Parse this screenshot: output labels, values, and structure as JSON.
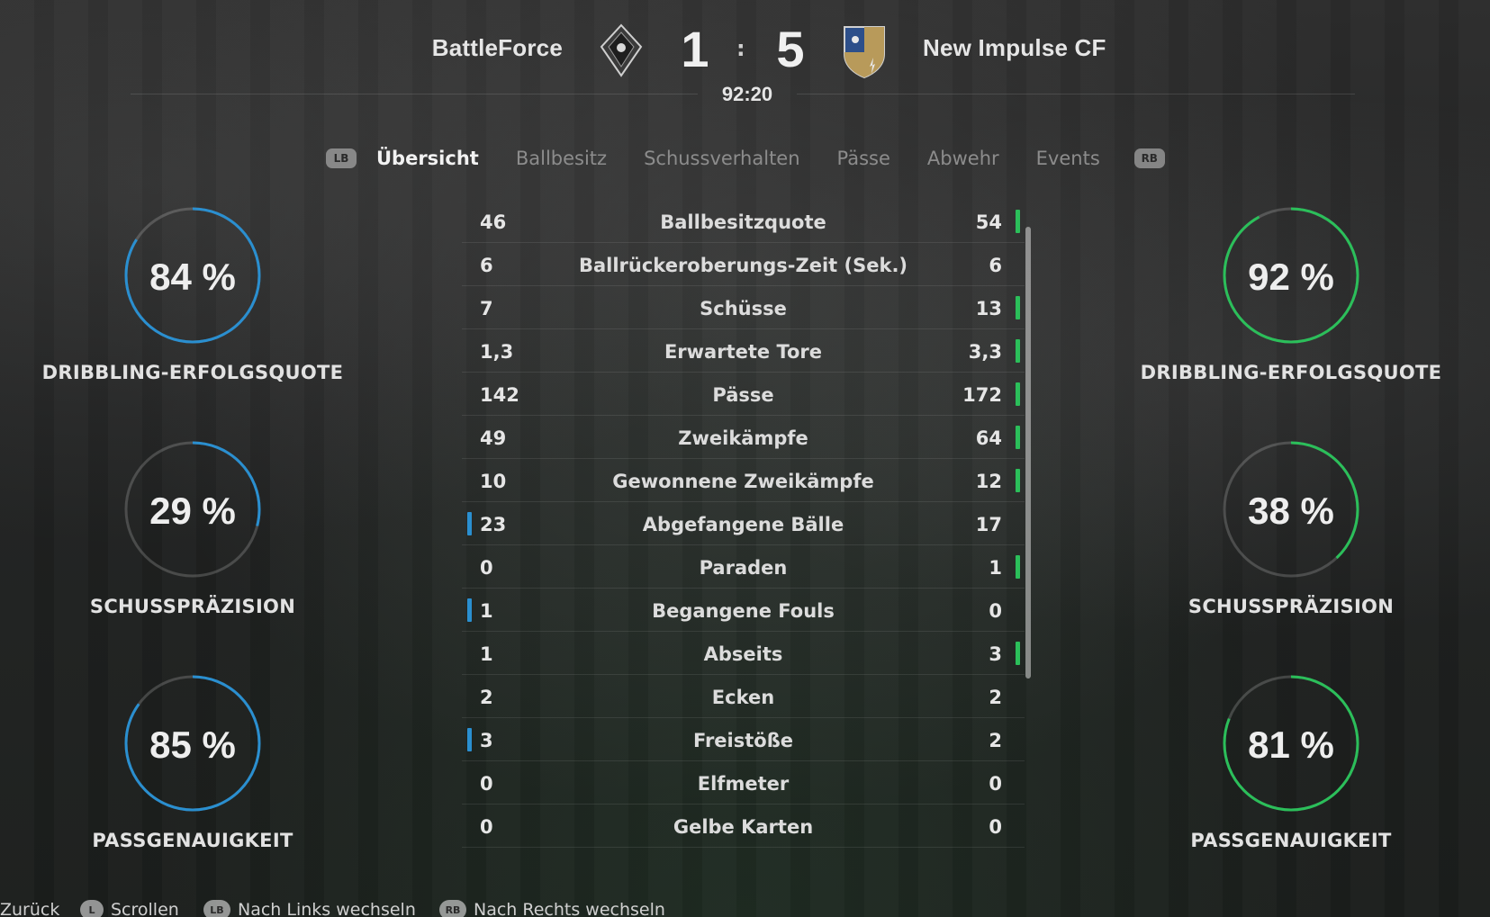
{
  "match": {
    "home_team": "BattleForce",
    "away_team": "New Impulse CF",
    "home_score": "1",
    "away_score": "5",
    "separator": ":",
    "clock": "92:20"
  },
  "colors": {
    "home_accent": "#2a8fd0",
    "away_accent": "#2bbf5a"
  },
  "tabs": {
    "left_button": "LB",
    "right_button": "RB",
    "items": [
      "Übersicht",
      "Ballbesitz",
      "Schussverhalten",
      "Pässe",
      "Abwehr",
      "Events"
    ],
    "active": "Übersicht"
  },
  "stats": [
    {
      "home": "46",
      "label": "Ballbesitzquote",
      "away": "54",
      "leader": "away"
    },
    {
      "home": "6",
      "label": "Ballrückeroberungs-Zeit (Sek.)",
      "away": "6",
      "leader": "none"
    },
    {
      "home": "7",
      "label": "Schüsse",
      "away": "13",
      "leader": "away"
    },
    {
      "home": "1,3",
      "label": "Erwartete Tore",
      "away": "3,3",
      "leader": "away"
    },
    {
      "home": "142",
      "label": "Pässe",
      "away": "172",
      "leader": "away"
    },
    {
      "home": "49",
      "label": "Zweikämpfe",
      "away": "64",
      "leader": "away"
    },
    {
      "home": "10",
      "label": "Gewonnene Zweikämpfe",
      "away": "12",
      "leader": "away"
    },
    {
      "home": "23",
      "label": "Abgefangene Bälle",
      "away": "17",
      "leader": "home"
    },
    {
      "home": "0",
      "label": "Paraden",
      "away": "1",
      "leader": "away"
    },
    {
      "home": "1",
      "label": "Begangene Fouls",
      "away": "0",
      "leader": "home"
    },
    {
      "home": "1",
      "label": "Abseits",
      "away": "3",
      "leader": "away"
    },
    {
      "home": "2",
      "label": "Ecken",
      "away": "2",
      "leader": "none"
    },
    {
      "home": "3",
      "label": "Freistöße",
      "away": "2",
      "leader": "home"
    },
    {
      "home": "0",
      "label": "Elfmeter",
      "away": "0",
      "leader": "none"
    },
    {
      "home": "0",
      "label": "Gelbe Karten",
      "away": "0",
      "leader": "none"
    }
  ],
  "gauges": {
    "home": [
      {
        "value": 84,
        "text": "84 %",
        "label": "DRIBBLING-ERFOLGSQUOTE"
      },
      {
        "value": 29,
        "text": "29 %",
        "label": "SCHUSSPRÄZISION"
      },
      {
        "value": 85,
        "text": "85 %",
        "label": "PASSGENAUIGKEIT"
      }
    ],
    "away": [
      {
        "value": 92,
        "text": "92 %",
        "label": "DRIBBLING-ERFOLGSQUOTE"
      },
      {
        "value": 38,
        "text": "38 %",
        "label": "SCHUSSPRÄZISION"
      },
      {
        "value": 81,
        "text": "81 %",
        "label": "PASSGENAUIGKEIT"
      }
    ]
  },
  "footer": {
    "back": "Zurück",
    "scroll_glyph": "L",
    "scroll": "Scrollen",
    "left_glyph": "LB",
    "left": "Nach Links wechseln",
    "right_glyph": "RB",
    "right": "Nach Rechts wechseln"
  }
}
